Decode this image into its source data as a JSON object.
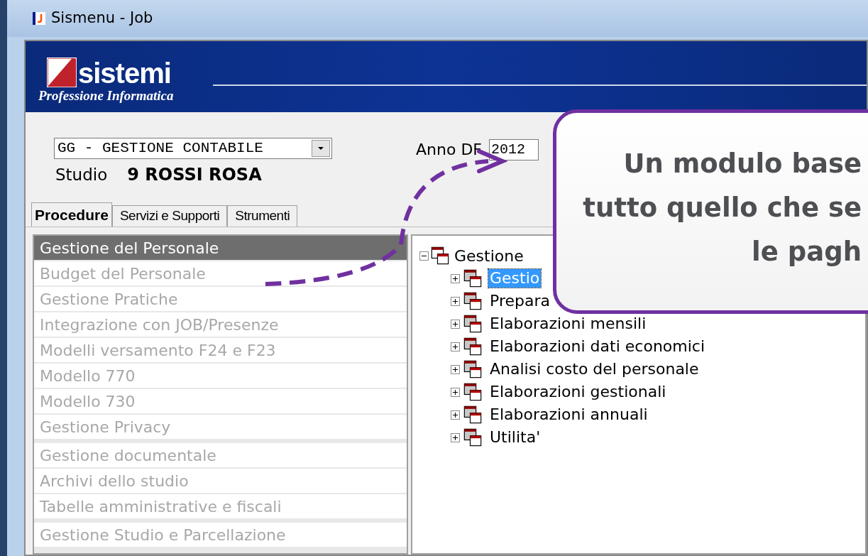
{
  "window": {
    "title": "Sismenu - Job"
  },
  "banner": {
    "logo_text": "sistemi",
    "tagline": "Professione Informatica"
  },
  "form": {
    "module_select": {
      "value": "GG - GESTIONE CONTABILE"
    },
    "studio_label": "Studio",
    "studio_value": "9 ROSSI ROSA",
    "year_label": "Anno DF",
    "year_value": "2012"
  },
  "tabs": [
    {
      "label": "Procedure",
      "selected": true
    },
    {
      "label": "Servizi e Supporti",
      "selected": false
    },
    {
      "label": "Strumenti",
      "selected": false
    }
  ],
  "sidebar": {
    "groups": [
      [
        {
          "label": "Gestione del Personale",
          "selected": true
        },
        {
          "label": "Budget del Personale",
          "selected": false
        },
        {
          "label": "Gestione Pratiche",
          "selected": false
        },
        {
          "label": "Integrazione con JOB/Presenze",
          "selected": false
        },
        {
          "label": "Modelli versamento F24 e F23",
          "selected": false
        },
        {
          "label": "Modello 770",
          "selected": false
        },
        {
          "label": "Modello 730",
          "selected": false
        },
        {
          "label": "Gestione Privacy",
          "selected": false
        }
      ],
      [
        {
          "label": "Gestione documentale",
          "selected": false
        },
        {
          "label": "Archivi dello studio",
          "selected": false
        },
        {
          "label": "Tabelle amministrative e fiscali",
          "selected": false
        }
      ],
      [
        {
          "label": "Gestione Studio e Parcellazione",
          "selected": false
        }
      ]
    ]
  },
  "tree": {
    "label": "Gestione",
    "expanded": true,
    "children": [
      {
        "label": "Gestio",
        "expanded": false,
        "selected": true
      },
      {
        "label": "Prepara",
        "expanded": false,
        "selected": false
      },
      {
        "label": "Elaborazioni mensili",
        "expanded": false,
        "selected": false
      },
      {
        "label": "Elaborazioni dati economici",
        "expanded": false,
        "selected": false
      },
      {
        "label": "Analisi costo del personale",
        "expanded": false,
        "selected": false
      },
      {
        "label": "Elaborazioni gestionali",
        "expanded": false,
        "selected": false
      },
      {
        "label": "Elaborazioni annuali",
        "expanded": false,
        "selected": false
      },
      {
        "label": "Utilita'",
        "expanded": false,
        "selected": false
      }
    ]
  },
  "callout": {
    "lines": [
      "Un modulo base",
      "tutto quello che se",
      "le pagh"
    ]
  }
}
